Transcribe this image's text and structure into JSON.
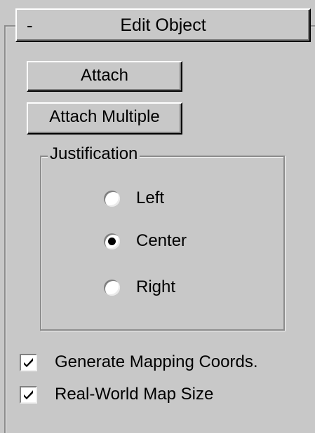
{
  "rollout": {
    "toggle": "-",
    "title": "Edit Object"
  },
  "buttons": {
    "attach": "Attach",
    "attach_multiple": "Attach Multiple"
  },
  "justification": {
    "label": "Justification",
    "options": [
      {
        "label": "Left",
        "checked": false
      },
      {
        "label": "Center",
        "checked": true
      },
      {
        "label": "Right",
        "checked": false
      }
    ]
  },
  "checkboxes": [
    {
      "label": "Generate Mapping Coords.",
      "checked": true
    },
    {
      "label": "Real-World Map Size",
      "checked": true
    }
  ]
}
